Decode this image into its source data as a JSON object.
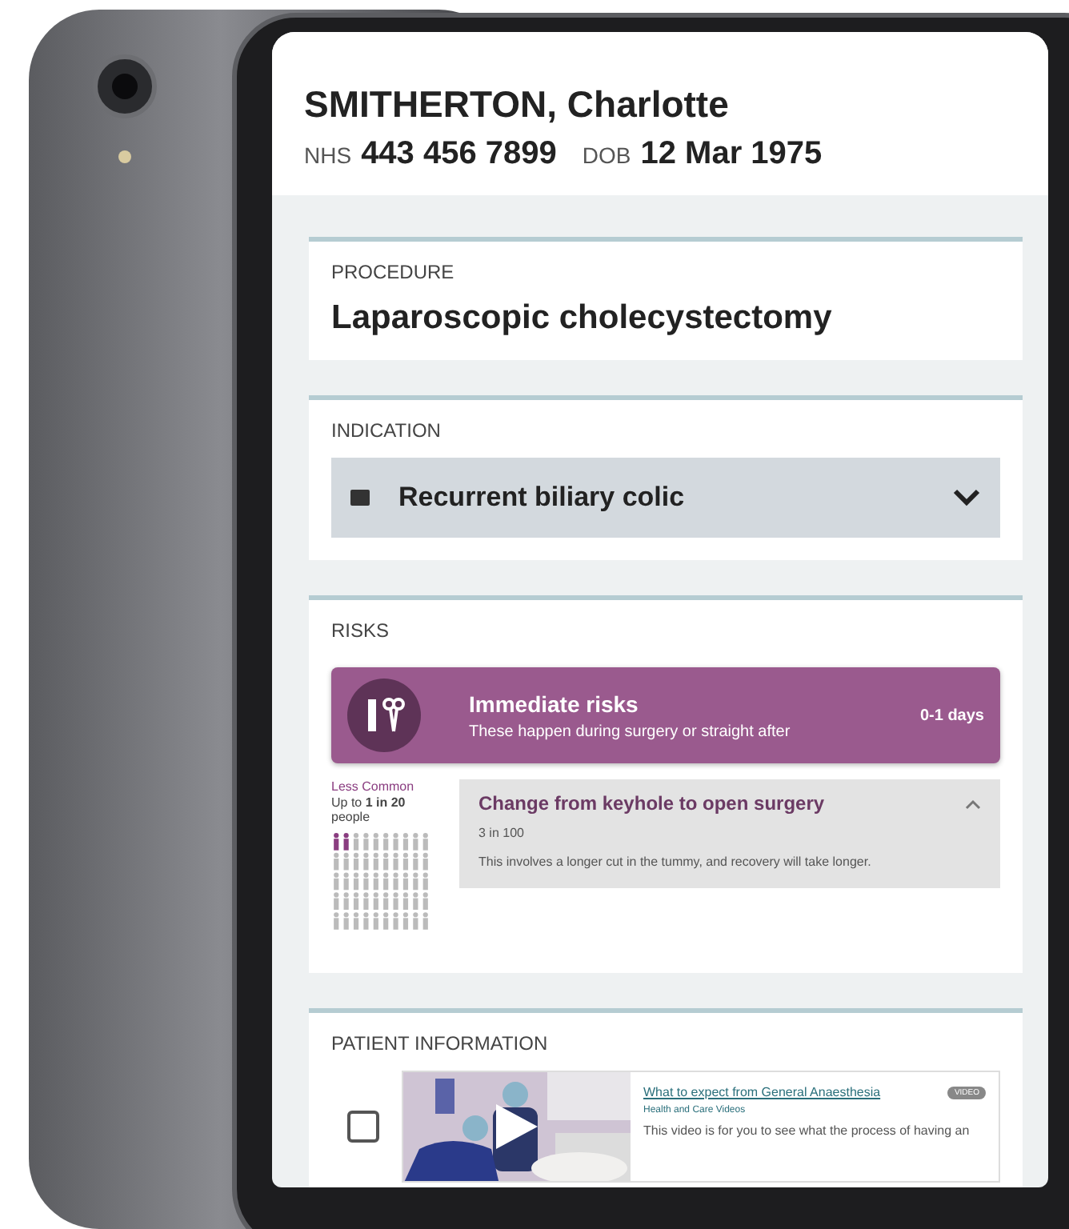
{
  "patient": {
    "name": "SMITHERTON, Charlotte",
    "nhs_label": "NHS",
    "nhs": "443 456 7899",
    "dob_label": "DOB",
    "dob": "12 Mar 1975"
  },
  "procedure": {
    "label": "PROCEDURE",
    "value": "Laparoscopic cholecystectomy"
  },
  "indication": {
    "label": "INDICATION",
    "value": "Recurrent biliary colic",
    "expanded": false
  },
  "risks": {
    "label": "RISKS",
    "group": {
      "title": "Immediate risks",
      "subtitle": "These happen during surgery or straight after",
      "timing": "0-1 days"
    },
    "items": [
      {
        "frequency": "Less Common",
        "rate_prefix": "Up to ",
        "rate": "1 in 20",
        "rate_suffix": " people",
        "title": "Change from keyhole to open surgery",
        "odds": "3 in 100",
        "description": "This involves a longer cut in the tummy, and recovery will take longer.",
        "expanded": true
      }
    ]
  },
  "patient_information": {
    "label": "PATIENT INFORMATION",
    "items": [
      {
        "kind": "video",
        "checked": false,
        "title": "What to expect from General Anaesthesia",
        "source": "Health and Care Videos",
        "badge": "VIDEO",
        "description": "This video is for you to see what the process of having an"
      }
    ]
  }
}
